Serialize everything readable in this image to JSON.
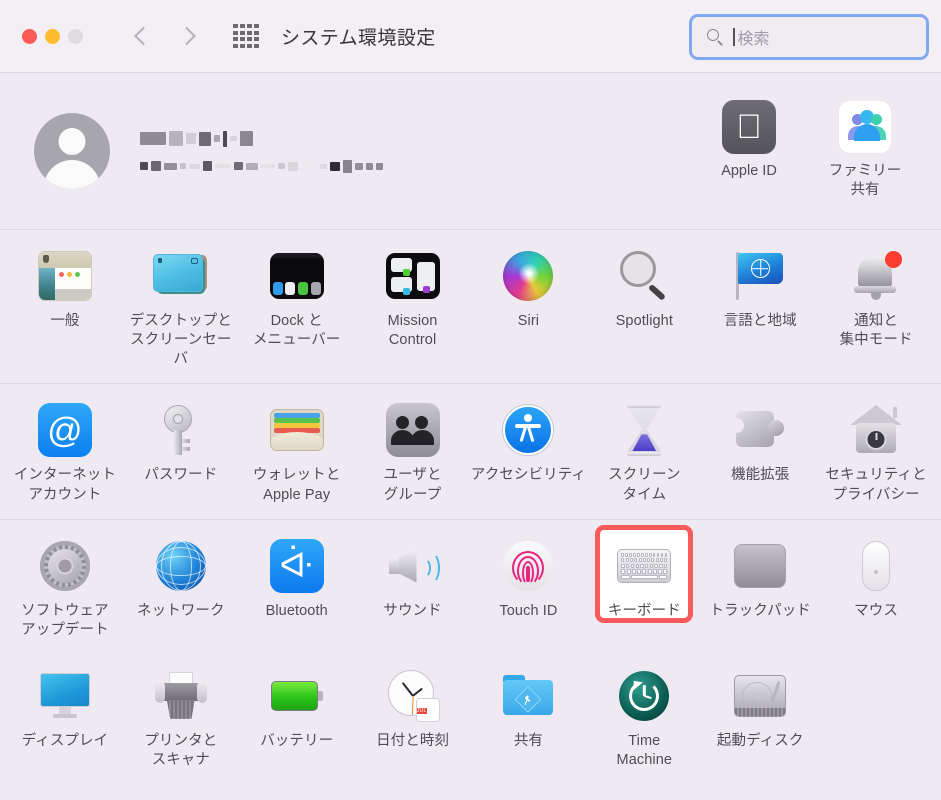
{
  "window": {
    "title": "システム環境設定",
    "traffic_lights": [
      "close",
      "minimize",
      "zoom"
    ],
    "back_label": "戻る",
    "forward_label": "進む",
    "grid_label": "すべてを表示"
  },
  "search": {
    "placeholder": "検索",
    "value": "",
    "focused": true,
    "focus_ring_color": "#82a9f0"
  },
  "account": {
    "name_redacted": true,
    "apple_id_redacted": true,
    "items": [
      {
        "label": "Apple ID",
        "icon": "apple-id-icon"
      },
      {
        "label": "ファミリー\n共有",
        "icon": "family-sharing-icon"
      }
    ]
  },
  "highlight": {
    "target": "キーボード",
    "color": "#fa5a5a"
  },
  "sections": [
    {
      "name": "personalization",
      "items": [
        {
          "label": "一般",
          "icon": "general-icon"
        },
        {
          "label": "デスクトップと\nスクリーンセーバ",
          "icon": "desktop-screensaver-icon"
        },
        {
          "label": "Dock と\nメニューバー",
          "icon": "dock-menubar-icon"
        },
        {
          "label": "Mission\nControl",
          "icon": "mission-control-icon"
        },
        {
          "label": "Siri",
          "icon": "siri-icon"
        },
        {
          "label": "Spotlight",
          "icon": "spotlight-icon"
        },
        {
          "label": "言語と地域",
          "icon": "language-region-icon"
        },
        {
          "label": "通知と\n集中モード",
          "icon": "notifications-focus-icon"
        }
      ]
    },
    {
      "name": "accounts-security",
      "items": [
        {
          "label": "インターネット\nアカウント",
          "icon": "internet-accounts-icon"
        },
        {
          "label": "パスワード",
          "icon": "passwords-icon"
        },
        {
          "label": "ウォレットと\nApple Pay",
          "icon": "wallet-applepay-icon"
        },
        {
          "label": "ユーザと\nグループ",
          "icon": "users-groups-icon"
        },
        {
          "label": "アクセシビリティ",
          "icon": "accessibility-icon"
        },
        {
          "label": "スクリーン\nタイム",
          "icon": "screen-time-icon"
        },
        {
          "label": "機能拡張",
          "icon": "extensions-icon"
        },
        {
          "label": "セキュリティと\nプライバシー",
          "icon": "security-privacy-icon"
        }
      ]
    },
    {
      "name": "hardware",
      "items": [
        {
          "label": "ソフトウェア\nアップデート",
          "icon": "software-update-icon"
        },
        {
          "label": "ネットワーク",
          "icon": "network-icon"
        },
        {
          "label": "Bluetooth",
          "icon": "bluetooth-icon"
        },
        {
          "label": "サウンド",
          "icon": "sound-icon"
        },
        {
          "label": "Touch ID",
          "icon": "touch-id-icon"
        },
        {
          "label": "キーボード",
          "icon": "keyboard-icon"
        },
        {
          "label": "トラックパッド",
          "icon": "trackpad-icon"
        },
        {
          "label": "マウス",
          "icon": "mouse-icon"
        },
        {
          "label": "ディスプレイ",
          "icon": "display-icon"
        },
        {
          "label": "プリンタと\nスキャナ",
          "icon": "printers-scanners-icon"
        },
        {
          "label": "バッテリー",
          "icon": "battery-icon"
        },
        {
          "label": "日付と時刻",
          "icon": "date-time-icon"
        },
        {
          "label": "共有",
          "icon": "sharing-icon"
        },
        {
          "label": "Time\nMachine",
          "icon": "time-machine-icon"
        },
        {
          "label": "起動ディスク",
          "icon": "startup-disk-icon"
        }
      ]
    }
  ],
  "icon_details": {
    "date_time": {
      "month": "JUL",
      "day": "17"
    },
    "internet_accounts_glyph": "@",
    "bluetooth_glyph": "ᛒ",
    "apple_glyph": ""
  }
}
